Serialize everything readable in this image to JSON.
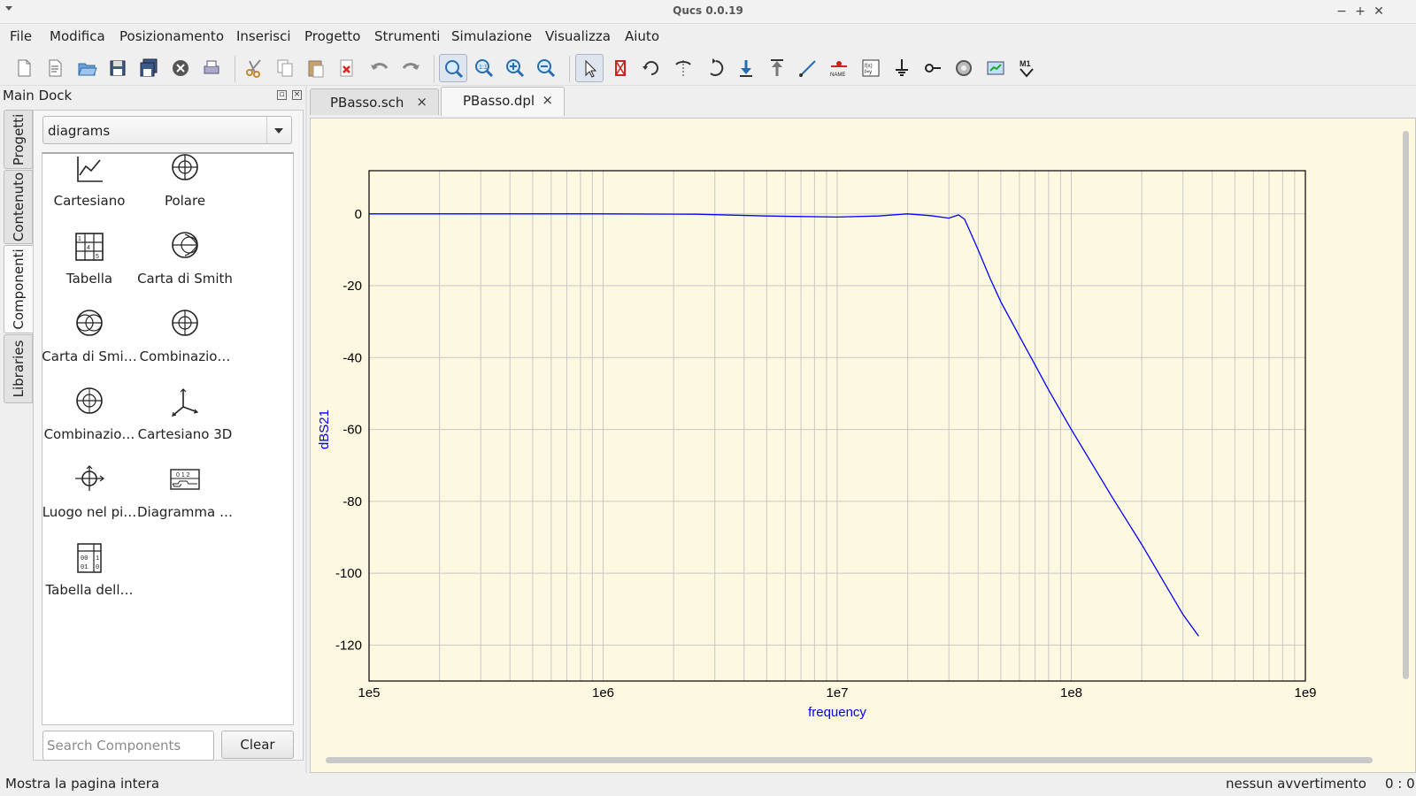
{
  "window": {
    "title": "Qucs 0.0.19",
    "controls": [
      "−",
      "+",
      "✕"
    ]
  },
  "menu": [
    "File",
    "Modifica",
    "Posizionamento",
    "Inserisci",
    "Progetto",
    "Strumenti",
    "Simulazione",
    "Visualizza",
    "Aiuto"
  ],
  "toolbar": {
    "file_group": [
      "new-file-icon",
      "new-text-icon",
      "open-icon",
      "save-icon",
      "save-all-icon",
      "close-icon",
      "print-icon"
    ],
    "edit_group": [
      "cut-icon",
      "copy-icon",
      "paste-icon",
      "delete-icon",
      "undo-icon",
      "redo-icon"
    ],
    "view_group": [
      "view-all-icon",
      "view-one-to-one-icon",
      "zoom-in-icon",
      "zoom-out-icon"
    ],
    "tools_group": [
      "select-icon",
      "deactivate-icon",
      "rotate-icon",
      "mirror-icon",
      "mirror-y-icon",
      "enter-subcircuit-icon",
      "exit-subcircuit-icon",
      "wire-icon",
      "wire-label-icon",
      "equation-icon",
      "ground-icon",
      "port-icon",
      "simulate-icon",
      "display-results-icon",
      "marker-icon"
    ]
  },
  "dock": {
    "title": "Main Dock",
    "tabs": [
      "Progetti",
      "Contenuto",
      "Componenti",
      "Libraries"
    ],
    "active_tab": "Componenti",
    "category": "diagrams",
    "components": [
      {
        "label": "Cartesiano",
        "icon": "cartesian-diagram-icon"
      },
      {
        "label": "Polare",
        "icon": "polar-diagram-icon"
      },
      {
        "label": "Tabella",
        "icon": "tabular-icon"
      },
      {
        "label": "Carta di Smith",
        "icon": "smith-chart-icon"
      },
      {
        "label": "Carta di Smi…",
        "icon": "admittance-smith-icon"
      },
      {
        "label": "Combinazio…",
        "icon": "polar-smith-combo-icon"
      },
      {
        "label": "Combinazio…",
        "icon": "smith-polar-combo-icon"
      },
      {
        "label": "Cartesiano 3D",
        "icon": "cartesian-3d-icon"
      },
      {
        "label": "Luogo nel pi…",
        "icon": "locus-curve-icon"
      },
      {
        "label": "Diagramma …",
        "icon": "timing-diagram-icon"
      },
      {
        "label": "Tabella dell…",
        "icon": "truth-table-icon"
      }
    ],
    "search_placeholder": "Search Components",
    "clear_label": "Clear"
  },
  "documents": {
    "tabs": [
      {
        "name": "PBasso.sch",
        "close": "×"
      },
      {
        "name": "PBasso.dpl",
        "close": "×"
      }
    ],
    "active": "PBasso.dpl"
  },
  "chart_data": {
    "type": "line",
    "xlabel": "frequency",
    "ylabel": "dBS21",
    "xscale": "log",
    "xlim": [
      100000,
      1000000000
    ],
    "ylim": [
      -130,
      12
    ],
    "xticks": [
      "1e5",
      "1e6",
      "1e7",
      "1e8",
      "1e9"
    ],
    "yticks": [
      0,
      -20,
      -40,
      -60,
      -80,
      -100,
      -120
    ],
    "grid": true,
    "colors": {
      "background": "#fdf8e0",
      "grid": "#c8c8c8",
      "series": "#0000ff",
      "ylabel": "#0000ff",
      "xlabel": "#0000ff"
    },
    "series": [
      {
        "x": [
          100000,
          1000000,
          2500000,
          5000000,
          10000000,
          15000000,
          20000000,
          25000000,
          30000000,
          33000000,
          35000000,
          37000000,
          40000000,
          45000000,
          50000000,
          60000000,
          70000000,
          80000000,
          100000000,
          150000000,
          200000000,
          300000000,
          350000000
        ],
        "y": [
          0,
          0,
          -0.1,
          -0.6,
          -0.9,
          -0.6,
          0,
          -0.5,
          -1.2,
          -0.3,
          -1.5,
          -5,
          -10,
          -18,
          -24.5,
          -34,
          -42,
          -49,
          -60,
          -79,
          -92,
          -111.5,
          -117.5
        ]
      }
    ]
  },
  "status": {
    "message": "Mostra la pagina intera",
    "warnings": "nessun avvertimento",
    "position": "0 : 0"
  }
}
